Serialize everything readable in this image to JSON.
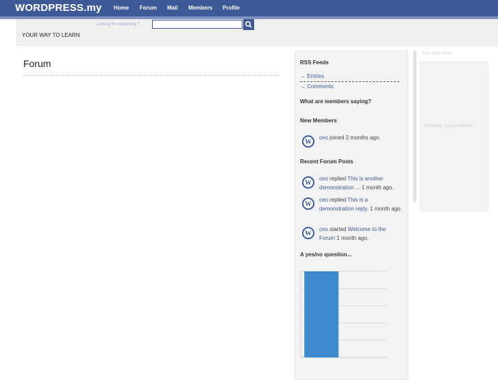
{
  "header": {
    "logo": "WORDPRESS.my",
    "nav": [
      "Home",
      "Forum",
      "Mail",
      "Members",
      "Profile"
    ],
    "search_hint": "Looking for something ?",
    "tagline": "YOUR WAY TO LEARN"
  },
  "main": {
    "title": "Forum"
  },
  "sidebar": {
    "rss_title": "RSS Feeds",
    "rss_links": [
      "→ Entries",
      "→ Comments"
    ],
    "saying_title": "What are members saying?",
    "new_members_title": "New Members",
    "new_member": {
      "user": "ceo",
      "text": " joined 2 months ago."
    },
    "recent_title": "Recent Forum Posts",
    "posts": [
      {
        "user": "ceo",
        "action": " replied ",
        "topic": "This is another demonstration ...",
        "time": " 1 month ago."
      },
      {
        "user": "ceo",
        "action": " replied ",
        "topic": "This is a demonstration reply.",
        "time": " 1 month ago."
      },
      {
        "user": "ceo",
        "action": " started ",
        "topic": "Welcome to the Forum",
        "time": " 1 month ago."
      }
    ],
    "poll_title": "A yes/no question..."
  },
  "ads": {
    "label": "Your Ads Here",
    "text": "Promote your products"
  },
  "colors": {
    "brand": "#3e5a96",
    "strip": "#7f92c2",
    "bar": "#3d8bcd"
  },
  "chart_data": {
    "type": "bar",
    "categories": [
      "",
      ""
    ],
    "values": [
      5,
      0
    ],
    "ylim": [
      0,
      5
    ],
    "grid": true
  }
}
